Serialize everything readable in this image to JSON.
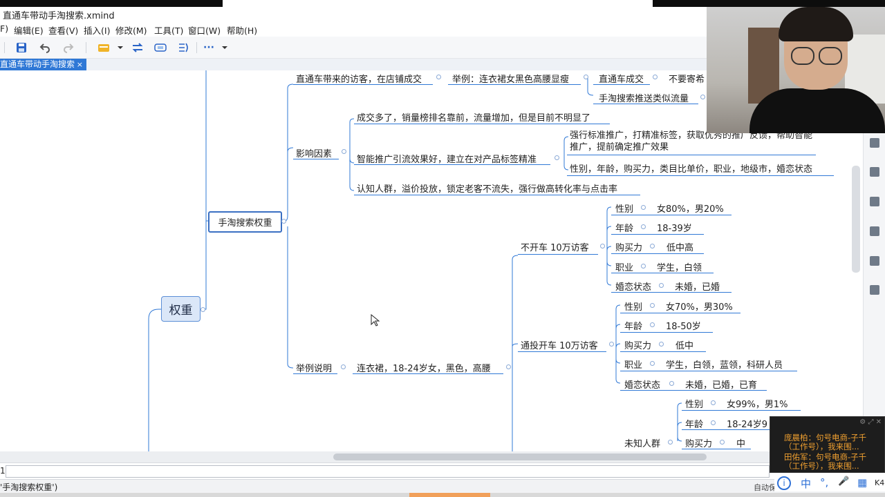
{
  "window": {
    "title": "直通车带动手淘搜索.xmind"
  },
  "menu": [
    "F)",
    "编辑(E)",
    "查看(V)",
    "插入(I)",
    "修改(M)",
    "工具(T)",
    "窗口(W)",
    "帮助(H)"
  ],
  "tab": {
    "label": "直通车带动手淘搜索",
    "close": "×"
  },
  "toolbar": {
    "more": "···"
  },
  "mindmap": {
    "root": "权重",
    "main": "手淘搜索权重",
    "branch1": "直通车带来的访客，在店铺成交",
    "example1": "举例：连衣裙女黑色高腰显瘦",
    "ztc_deal": "直通车成交",
    "ztc_deal_child": "不要寄希",
    "push_similar": "手淘搜索推送类似流量",
    "factors": "影响因素",
    "factor1": "成交多了，销量榜排名靠前，流量增加，但是目前不明显了",
    "factor2": "智能推广引流效果好，建立在对产品标签精准",
    "factor2_a": "强行标准推广，打精准标签，获取优秀的推广反馈，帮助智能推广，提前确定推广效果",
    "factor2_b": "性别，年龄，购买力，类目比单价，职业，地级市，婚恋状态",
    "factor3": "认知人群，溢价投放，锁定老客不流失，强行做高转化率与点击率",
    "example_label": "举例说明",
    "example_product": "连衣裙，18-24岁女，黑色，高腰",
    "group1": {
      "label": "不开车 10万访客",
      "rows": [
        {
          "k": "性别",
          "v": "女80%，男20%"
        },
        {
          "k": "年龄",
          "v": "18-39岁"
        },
        {
          "k": "购买力",
          "v": "低中高"
        },
        {
          "k": "职业",
          "v": "学生，白领"
        },
        {
          "k": "婚恋状态",
          "v": "未婚，已婚"
        }
      ]
    },
    "group2": {
      "label": "通投开车 10万访客",
      "rows": [
        {
          "k": "性别",
          "v": "女70%，男30%"
        },
        {
          "k": "年龄",
          "v": "18-50岁"
        },
        {
          "k": "购买力",
          "v": "低中"
        },
        {
          "k": "职业",
          "v": "学生，白领，蓝领，科研人员"
        },
        {
          "k": "婚恋状态",
          "v": "未婚，已婚，已育"
        }
      ]
    },
    "group3": {
      "label": "未知人群",
      "rows": [
        {
          "k": "性别",
          "v": "女99%，男1%"
        },
        {
          "k": "年龄",
          "v": "18-24岁9"
        },
        {
          "k": "购买力",
          "v": "中"
        }
      ]
    }
  },
  "input": {
    "line_number": "1"
  },
  "status": {
    "path": "'手淘搜索权重')",
    "auto": "自动保"
  },
  "chat": [
    {
      "text": "庞晨柏：句号电商-子千（工作号），我来围..."
    },
    {
      "text": "田佑军：句号电商-子千（工作号），我来围..."
    }
  ],
  "ime": {
    "lang": "中",
    "punct": "°,",
    "mic": "🎤",
    "grid": "▦"
  },
  "taskbar": {
    "k4": "K4"
  }
}
